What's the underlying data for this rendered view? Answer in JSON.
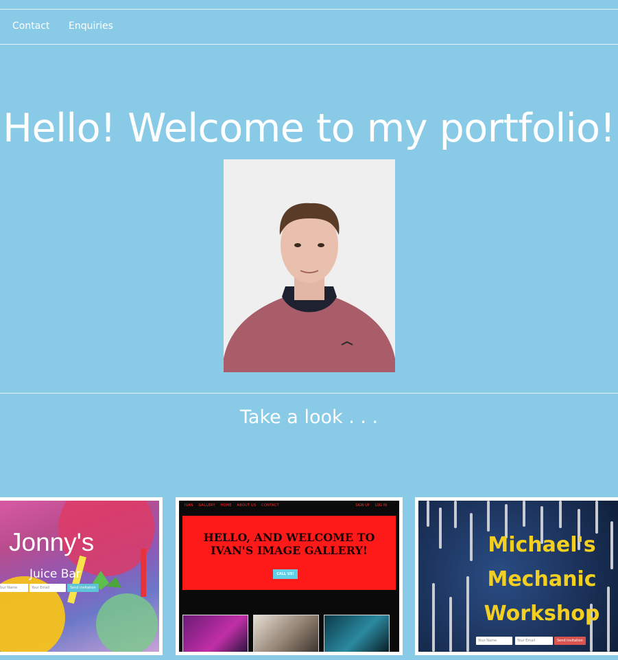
{
  "nav": {
    "items": [
      "Contact",
      "Enquiries"
    ]
  },
  "hero": {
    "headline": "Hello! Welcome to my portfolio!",
    "photo_alt": "Portrait photo"
  },
  "section": {
    "subheading": "Take a look . . ."
  },
  "projects": [
    {
      "title_line1": "Jonny's",
      "title_line2": "Juice Bar",
      "form": {
        "name_placeholder": "Your Name",
        "email_placeholder": "Your Email",
        "button": "Send invitation"
      }
    },
    {
      "nav_left": [
        "IVAN",
        "GALLERY",
        "HOME",
        "ABOUT US",
        "CONTACT"
      ],
      "nav_right": [
        "SIGN UP",
        "LOG IN"
      ],
      "hero_text": "HELLO, AND WELCOME TO IVAN'S IMAGE GALLERY!",
      "button": "CALL US!"
    },
    {
      "title_lines": [
        "Michael's",
        "Mechanic",
        "Workshop"
      ],
      "form": {
        "name_placeholder": "Your Name",
        "email_placeholder": "Your Email",
        "button": "Send invitation"
      }
    }
  ],
  "colors": {
    "background": "#89cbe7",
    "text": "#ffffff",
    "accent_red": "#ff1a1a",
    "accent_yellow": "#f3cf22"
  }
}
